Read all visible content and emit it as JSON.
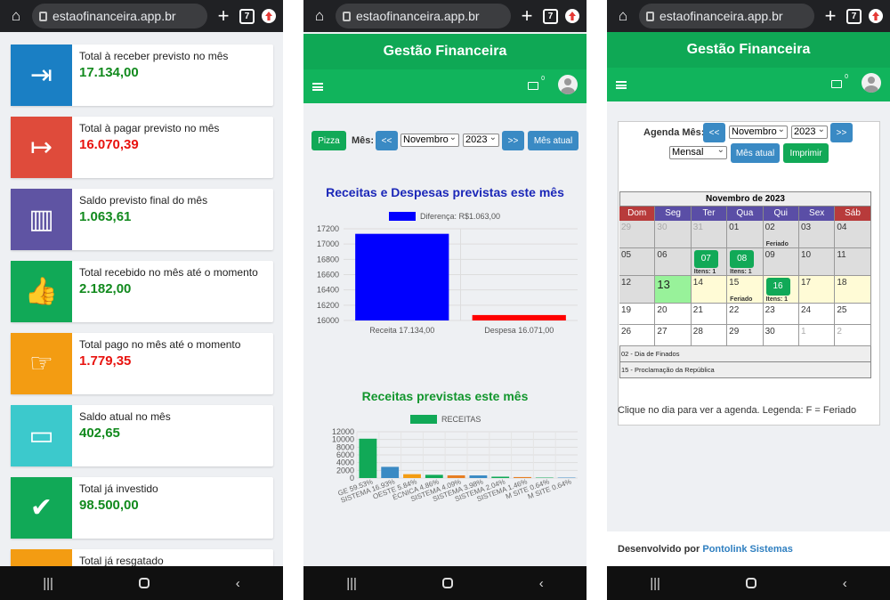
{
  "browser": {
    "url": "estaofinanceira.app.br",
    "tab_count": "7"
  },
  "phone1": {
    "cards": [
      {
        "label": "Total à receber previsto no mês",
        "value": "17.134,00",
        "color": "#1a7fc4",
        "value_color": "#128a1e",
        "icon": "login-icon"
      },
      {
        "label": "Total à pagar previsto no mês",
        "value": "16.070,39",
        "color": "#df4b3b",
        "value_color": "#e8130f",
        "icon": "logout-icon"
      },
      {
        "label": "Saldo previsto final do mês",
        "value": "1.063,61",
        "color": "#5f54a3",
        "value_color": "#128a1e",
        "icon": "bar-chart-icon"
      },
      {
        "label": "Total recebido no mês até o momento",
        "value": "2.182,00",
        "color": "#11a957",
        "value_color": "#128a1e",
        "icon": "thumbs-up-icon"
      },
      {
        "label": "Total pago no mês até o momento",
        "value": "1.779,35",
        "color": "#f39c12",
        "value_color": "#e8130f",
        "icon": "hand-point-icon"
      },
      {
        "label": "Saldo atual no mês",
        "value": "402,65",
        "color": "#3cc9cc",
        "value_color": "#128a1e",
        "icon": "money-bill-icon"
      },
      {
        "label": "Total já investido",
        "value": "98.500,00",
        "color": "#11a957",
        "value_color": "#128a1e",
        "icon": "check-icon"
      },
      {
        "label": "Total já resgatado",
        "value": "",
        "color": "#f39c12",
        "value_color": "#128a1e",
        "icon": "undo-icon"
      }
    ]
  },
  "app": {
    "title": "Gestão Financeira",
    "mail_count": "0"
  },
  "phone2": {
    "pizza_label": "Pizza",
    "mes_label": "Mês:",
    "prev_label": "<<",
    "next_label": ">>",
    "month": "Novembro",
    "year": "2023",
    "mes_atual_label": "Mês atual",
    "chart1_title": "Receitas e Despesas previstas este mês",
    "chart2_title": "Receitas previstas este mês"
  },
  "chart_data": [
    {
      "type": "bar",
      "title": "Receitas e Despesas previstas este mês",
      "legend": [
        "Diferença: R$1.063,00"
      ],
      "categories": [
        "Receita 17.134,00",
        "Despesa 16.071,00"
      ],
      "values": [
        17134,
        16071
      ],
      "colors": [
        "#0000ff",
        "#ff0000"
      ],
      "ylim": [
        16000,
        17200
      ],
      "yticks": [
        "17200",
        "17000",
        "16800",
        "16600",
        "16400",
        "16200",
        "16000"
      ]
    },
    {
      "type": "bar",
      "title": "Receitas previstas este mês",
      "legend": [
        "RECEITAS"
      ],
      "categories": [
        "GE 59.53%",
        "SISTEMA 16.93%",
        "OESTE 5.84%",
        "ÉCNICA 4.86%",
        "SISTEMA 4.09%",
        "SISTEMA 3.98%",
        "SISTEMA 2.04%",
        "SISTEMA 1.46%",
        "M SITE 0.64%",
        "M SITE 0.64%"
      ],
      "values": [
        10200,
        2900,
        1000,
        830,
        700,
        680,
        350,
        250,
        110,
        110
      ],
      "colors": [
        "#11a957",
        "#3a8ac4",
        "#f39c12",
        "#11a957",
        "#e67e22",
        "#3a8ac4",
        "#11a957",
        "#e67e22",
        "#11a957",
        "#3a8ac4"
      ],
      "ylim": [
        0,
        12000
      ],
      "yticks": [
        "12000",
        "10000",
        "8000",
        "6000",
        "4000",
        "2000",
        "0"
      ]
    }
  ],
  "phone3": {
    "agenda_label": "Agenda Mês:",
    "prev_label": "<<",
    "next_label": ">>",
    "month": "Novembro",
    "year": "2023",
    "mode": "Mensal",
    "mes_atual_label": "Mês atual",
    "imprimir_label": "Imprimir",
    "cal_title": "Novembro de 2023",
    "weekdays": [
      "Dom",
      "Seg",
      "Ter",
      "Qua",
      "Qui",
      "Sex",
      "Sáb"
    ],
    "weeks": [
      [
        {
          "d": "29",
          "o": 1
        },
        {
          "d": "30",
          "o": 1
        },
        {
          "d": "31",
          "o": 1
        },
        {
          "d": "01"
        },
        {
          "d": "02",
          "note": "Feriado"
        },
        {
          "d": "03"
        },
        {
          "d": "04"
        }
      ],
      [
        {
          "d": "05"
        },
        {
          "d": "06"
        },
        {
          "d": "07",
          "btn": 1,
          "note": "Itens: 1"
        },
        {
          "d": "08",
          "btn": 1,
          "note": "Itens: 1"
        },
        {
          "d": "09"
        },
        {
          "d": "10"
        },
        {
          "d": "11"
        }
      ],
      [
        {
          "d": "12"
        },
        {
          "d": "13",
          "today": 1
        },
        {
          "d": "14",
          "y": 1
        },
        {
          "d": "15",
          "y": 1,
          "note": "Feriado"
        },
        {
          "d": "16",
          "y": 1,
          "btn": 1,
          "note": "Itens: 1"
        },
        {
          "d": "17",
          "y": 1
        },
        {
          "d": "18",
          "y": 1
        }
      ],
      [
        {
          "d": "19",
          "w": 1
        },
        {
          "d": "20",
          "w": 1
        },
        {
          "d": "21",
          "w": 1
        },
        {
          "d": "22",
          "w": 1
        },
        {
          "d": "23",
          "w": 1
        },
        {
          "d": "24",
          "w": 1
        },
        {
          "d": "25",
          "w": 1
        }
      ],
      [
        {
          "d": "26",
          "w": 1
        },
        {
          "d": "27",
          "w": 1
        },
        {
          "d": "28",
          "w": 1
        },
        {
          "d": "29",
          "w": 1
        },
        {
          "d": "30",
          "w": 1
        },
        {
          "d": "1",
          "w": 1,
          "o": 1
        },
        {
          "d": "2",
          "w": 1,
          "o": 1
        }
      ]
    ],
    "holidays": [
      "02 - Dia de Finados",
      "15 - Proclamação da República"
    ],
    "hint": "Clique no dia para ver a agenda. Legenda: F = Feriado",
    "footer_prefix": "Desenvolvido por",
    "footer_link": "Pontolink Sistemas"
  }
}
